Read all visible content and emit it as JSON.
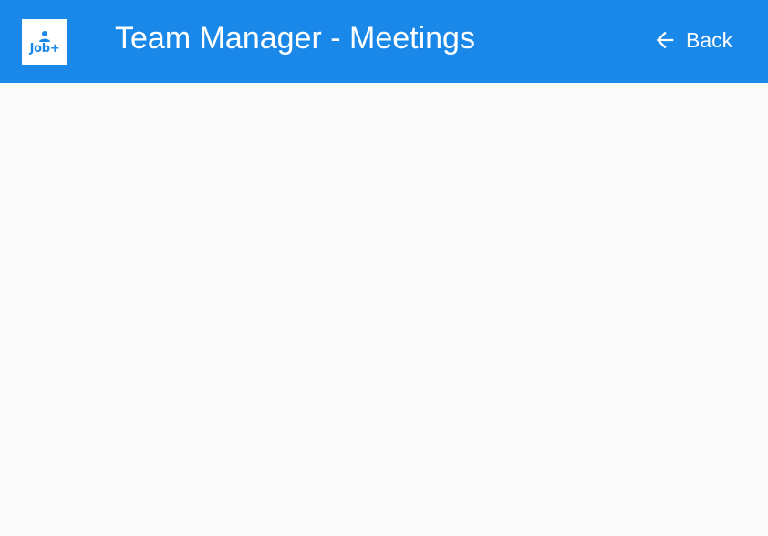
{
  "app_bar": {
    "logo_text": "Job+",
    "title": "Team Manager - Meetings",
    "back_label": "Back"
  },
  "colors": {
    "primary": "#1a88e8",
    "background": "#fafafa",
    "on_primary": "#ffffff"
  },
  "icons": {
    "logo_person": "person-icon",
    "back": "arrow-left-icon"
  }
}
